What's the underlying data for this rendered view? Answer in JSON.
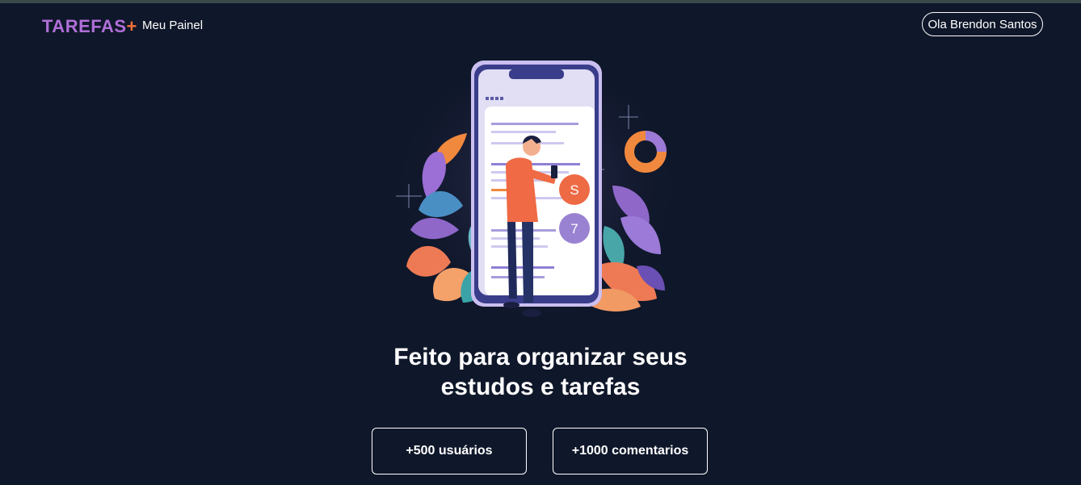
{
  "header": {
    "logo_text": "TAREFAS",
    "logo_plus": "+",
    "nav_link": "Meu Painel",
    "user_button": "Ola Brendon Santos"
  },
  "hero": {
    "title_line1": "Feito para organizar seus",
    "title_line2": "estudos e tarefas",
    "illustration_badge_1": "S",
    "illustration_badge_2": "7"
  },
  "stats": [
    {
      "label": "+500 usuários"
    },
    {
      "label": "+1000 comentarios"
    }
  ],
  "colors": {
    "background": "#0f172a",
    "logo_purple": "#b06fd8",
    "logo_orange": "#f0703a"
  }
}
